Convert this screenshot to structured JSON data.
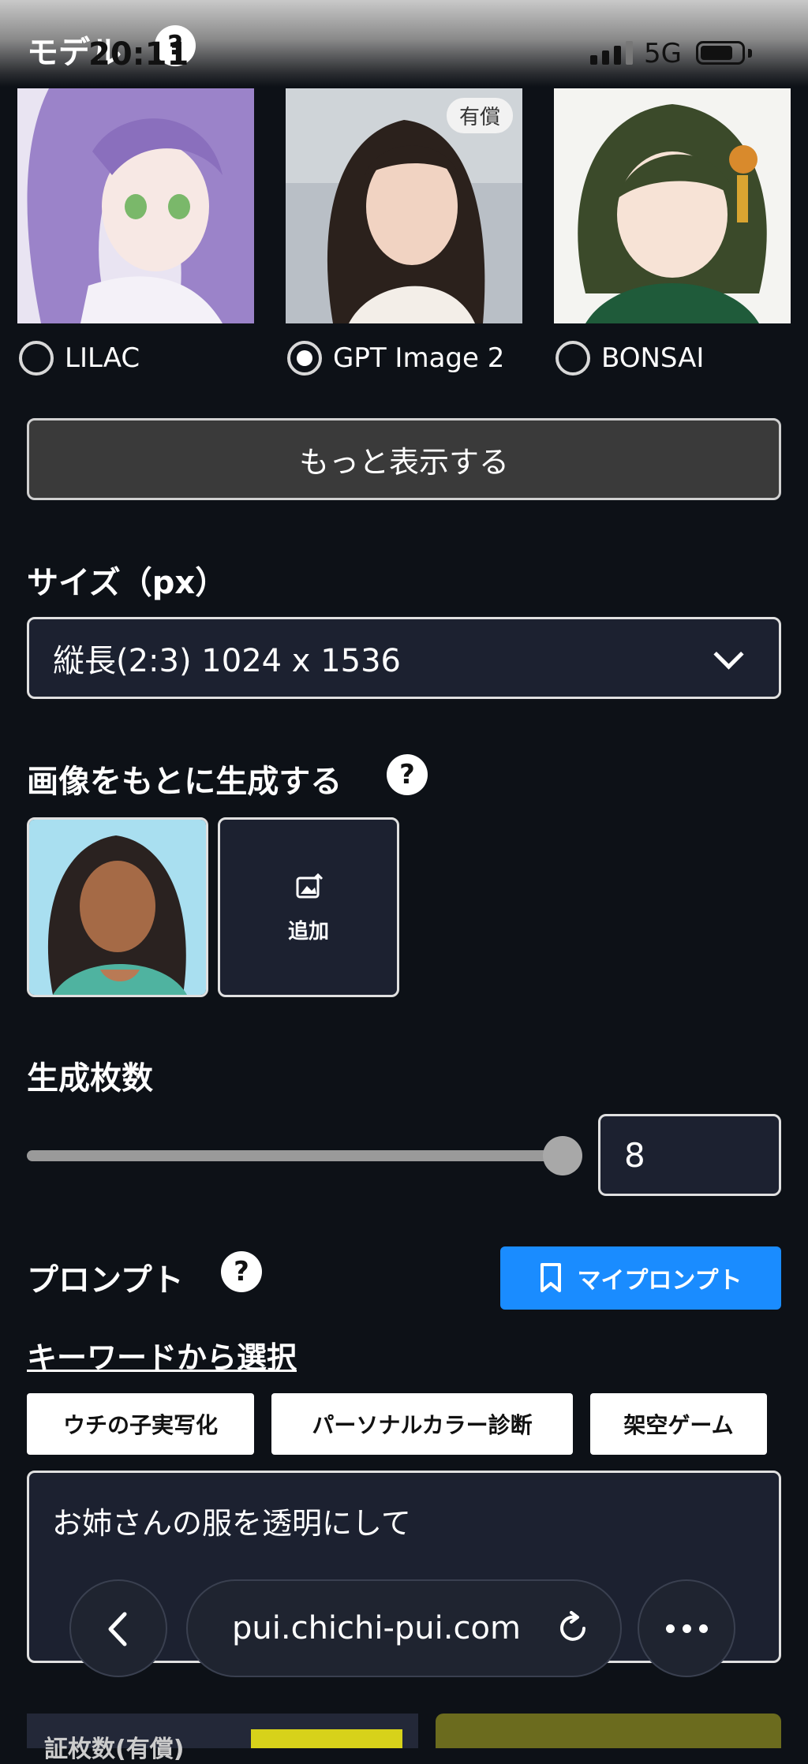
{
  "status_bar": {
    "time": "20:11",
    "network": "5G"
  },
  "header": {
    "title": "モデル",
    "help": "?"
  },
  "models": [
    {
      "name": "LILAC",
      "selected": false,
      "badge": ""
    },
    {
      "name": "GPT Image 2",
      "selected": true,
      "badge": "有償"
    },
    {
      "name": "BONSAI",
      "selected": false,
      "badge": ""
    }
  ],
  "more_button": "もっと表示する",
  "size": {
    "title": "サイズ（px）",
    "selected": "縦長(2:3) 1024 x 1536"
  },
  "image_ref": {
    "title": "画像をもとに生成する",
    "help": "?",
    "add_label": "追加"
  },
  "count": {
    "title": "生成枚数",
    "value": "8",
    "slider_fraction": 1.0
  },
  "prompt": {
    "title": "プロンプト",
    "help": "?",
    "my_prompt_button": "マイプロンプト",
    "keyword_link": "キーワードから選択",
    "chips": [
      "ウチの子実写化",
      "パーソナルカラー診断",
      "架空ゲーム"
    ],
    "text": "お姉さんの服を透明にして"
  },
  "browser": {
    "url": "pui.chichi-pui.com"
  },
  "bottom": {
    "label": "証枚数(有償)"
  },
  "colors": {
    "accent": "#1a8cff",
    "background": "#0d1117",
    "field": "#1c2130"
  }
}
